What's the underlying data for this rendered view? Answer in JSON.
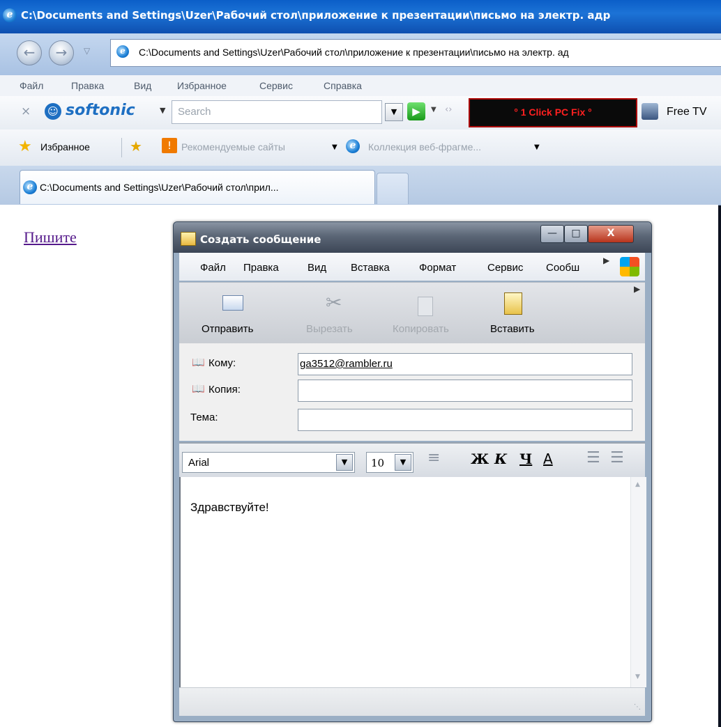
{
  "browser": {
    "title": "C:\\Documents and Settings\\Uzer\\Рабочий стол\\приложение к презентации\\письмо на электр. адр",
    "address": "C:\\Documents and Settings\\Uzer\\Рабочий стол\\приложение к презентации\\письмо на электр. ад",
    "menu": [
      "Файл",
      "Правка",
      "Вид",
      "Избранное",
      "Сервис",
      "Справка"
    ],
    "toolbar": {
      "brand": "softonic",
      "search_placeholder": "Search",
      "pcfix_label": "° 1 Click PC Fix °",
      "freetv_label": "Free TV"
    },
    "favorites": {
      "favorites_label": "Избранное",
      "suggested_sites": "Рекомендуемые сайты",
      "web_slices": "Коллекция веб-фрагме..."
    },
    "tab_title": "C:\\Documents and Settings\\Uzer\\Рабочий стол\\прил..."
  },
  "page": {
    "link_text": "Пишите"
  },
  "compose": {
    "title": "Создать сообщение",
    "menu": [
      "Файл",
      "Правка",
      "Вид",
      "Вставка",
      "Формат",
      "Сервис",
      "Сообш"
    ],
    "toolbar": {
      "send": "Отправить",
      "cut": "Вырезать",
      "copy": "Копировать",
      "paste": "Вставить"
    },
    "fields": {
      "to_label": "Кому:",
      "to_value": "ga3512@rambler.ru",
      "cc_label": "Копия:",
      "cc_value": "",
      "subject_label": "Тема:",
      "subject_value": ""
    },
    "format": {
      "font": "Arial",
      "size": "10",
      "bold": "Ж",
      "italic": "К",
      "underline": "Ч",
      "color": "А"
    },
    "body_text": "Здравствуйте!"
  },
  "colors": {
    "link": "#551a8b",
    "pcfix_text": "#ff2020",
    "softonic_blue": "#1e6fc2"
  }
}
